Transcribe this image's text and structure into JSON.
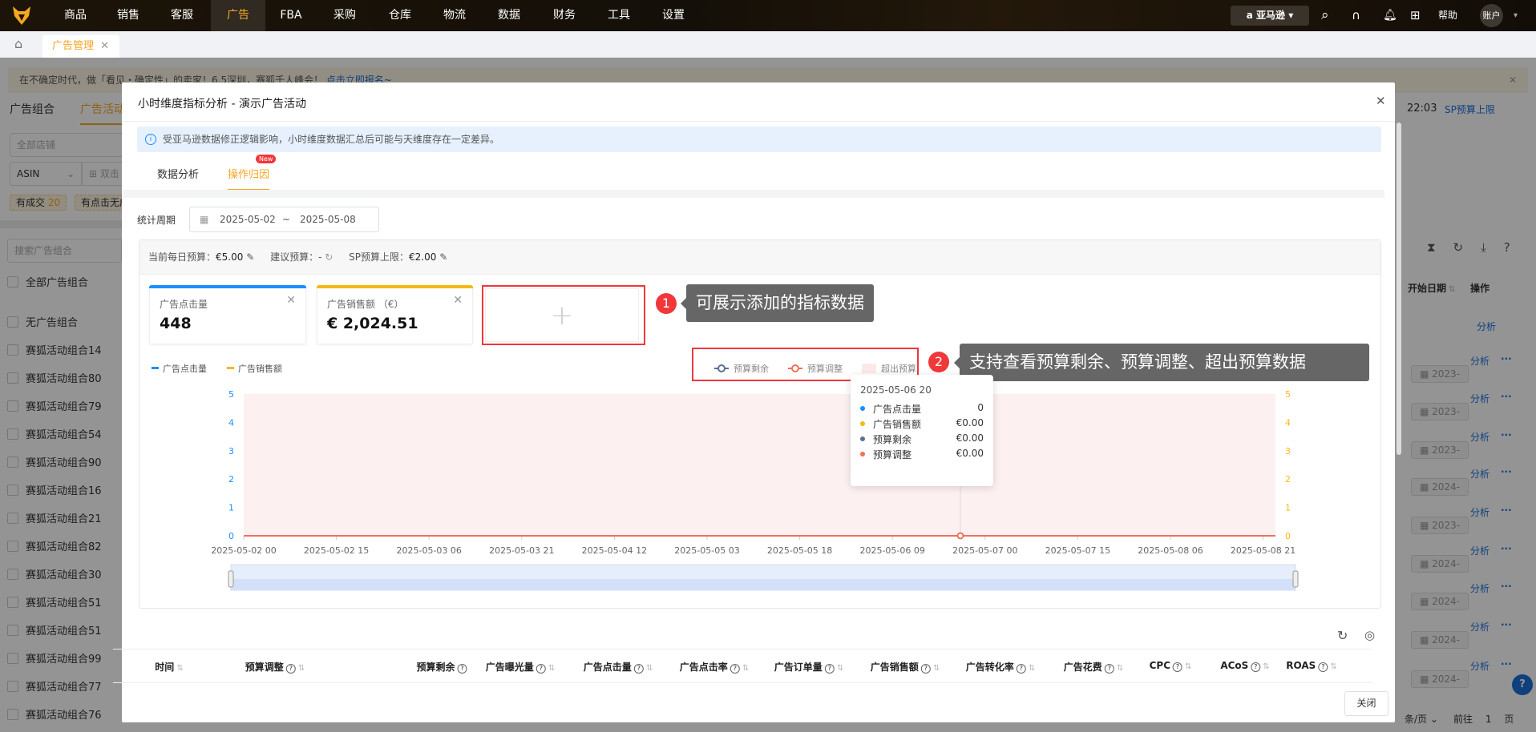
{
  "nav": {
    "items": [
      "商品",
      "销售",
      "客服",
      "广告",
      "FBA",
      "采购",
      "仓库",
      "物流",
      "数据",
      "财务",
      "工具",
      "设置"
    ],
    "active": "广告",
    "marketplace": "亚马逊",
    "help": "帮助",
    "account": "账户",
    "brand_color": "#f5a623"
  },
  "tabs": {
    "page_tab": "广告管理"
  },
  "background": {
    "banner": "在不确定时代，做「看见・确定性」的卖家！6.5深圳，赛狐千人峰会！",
    "banner_link": "点击立即报名~",
    "tab_group": "广告组合",
    "tab_campaign": "广告活动",
    "store_placeholder": "全部店铺",
    "asin_select": "ASIN",
    "search_hint": "双击",
    "filter1": "有成交",
    "filter1_count": "20",
    "filter2": "有点击无成",
    "group_search_placeholder": "搜索广告组合",
    "all_groups": "全部广告组合",
    "groups": [
      "无广告组合",
      "赛狐活动组合14",
      "赛狐活动组合80",
      "赛狐活动组合79",
      "赛狐活动组合54",
      "赛狐活动组合90",
      "赛狐活动组合16",
      "赛狐活动组合21",
      "赛狐活动组合82",
      "赛狐活动组合30",
      "赛狐活动组合51",
      "赛狐活动组合51",
      "赛狐活动组合99",
      "赛狐活动组合77",
      "赛狐活动组合76"
    ],
    "time": "22:03",
    "sp_limit": "SP预算上限",
    "col_start": "开始日期",
    "col_action": "操作",
    "action_analyze": "分析",
    "more": "···",
    "start_dates": [
      "2023-",
      "2023-",
      "2023-",
      "2024-",
      "2023-",
      "2024-",
      "2024-",
      "2024-",
      "2024-"
    ],
    "per_page": "条/页",
    "goto": "前往",
    "page": "1",
    "page_unit": "页"
  },
  "modal": {
    "title": "小时维度指标分析 - 演示广告活动",
    "alert": "受亚马逊数据修正逻辑影响，小时维度数据汇总后可能与天维度存在一定差异。",
    "tabs": [
      {
        "label": "数据分析"
      },
      {
        "label": "操作归因",
        "badge": "New",
        "active": true
      }
    ],
    "period_label": "统计周期",
    "date_start": "2025-05-02",
    "date_sep": "~",
    "date_end": "2025-05-08",
    "budget": {
      "daily_label": "当前每日预算：",
      "daily_value": "€5.00",
      "suggest_label": "建议预算：",
      "suggest_value": "-",
      "sp_label": "SP预算上限：",
      "sp_value": "€2.00"
    },
    "metrics": [
      {
        "label": "广告点击量",
        "value": "448",
        "color": "#1890ff"
      },
      {
        "label": "广告销售额 （€）",
        "value": "€ 2,024.51",
        "color": "#f5b914"
      }
    ],
    "callouts": [
      {
        "num": "1",
        "text": "可展示添加的指标数据"
      },
      {
        "num": "2",
        "text": "支持查看预算剩余、预算调整、超出预算数据"
      }
    ],
    "close": "关闭",
    "table_headers": [
      "时间",
      "预算调整",
      "预算剩余",
      "广告曝光量",
      "广告点击量",
      "广告点击率",
      "广告订单量",
      "广告销售额",
      "广告转化率",
      "广告花费",
      "CPC",
      "ACoS",
      "ROAS"
    ]
  },
  "chart_data": {
    "type": "line",
    "x_start": "2025-05-02 00",
    "x_end": "2025-05-08 23",
    "x_interval": "1 hour",
    "x_tick_labels": [
      "2025-05-02 00",
      "2025-05-02 15",
      "2025-05-03 06",
      "2025-05-03 21",
      "2025-05-04 12",
      "2025-05-05 03",
      "2025-05-05 18",
      "2025-05-06 09",
      "2025-05-07 00",
      "2025-05-07 15",
      "2025-05-08 06",
      "2025-05-08 21"
    ],
    "y_left": {
      "ticks": [
        0,
        1,
        2,
        3,
        4,
        5
      ],
      "range": [
        0,
        5
      ],
      "color": "#1890ff"
    },
    "y_right": {
      "ticks": [
        0,
        1,
        2,
        3,
        4,
        5
      ],
      "range": [
        0,
        5
      ],
      "color": "#f5b914"
    },
    "legend_left": [
      {
        "name": "广告点击量",
        "color": "#1890ff"
      },
      {
        "name": "广告销售额",
        "color": "#f5b914"
      }
    ],
    "legend_right": [
      {
        "name": "预算剩余",
        "color": "#5b6e96"
      },
      {
        "name": "预算调整",
        "color": "#f0705a"
      },
      {
        "name": "超出预算",
        "color": "#fdf0f0"
      }
    ],
    "series": [
      {
        "name": "广告点击量",
        "constant_value": 0
      },
      {
        "name": "广告销售额",
        "constant_value": 0
      },
      {
        "name": "预算剩余",
        "constant_value": 0
      },
      {
        "name": "预算调整",
        "constant_value": 0
      }
    ],
    "over_budget_range": [
      "2025-05-02 00",
      "2025-05-08 23"
    ],
    "tooltip": {
      "x": "2025-05-06 20",
      "rows": [
        {
          "name": "广告点击量",
          "value": "0",
          "color": "#1890ff"
        },
        {
          "name": "广告销售额",
          "value": "€0.00",
          "color": "#f5b914"
        },
        {
          "name": "预算剩余",
          "value": "€0.00",
          "color": "#5b6e96"
        },
        {
          "name": "预算调整",
          "value": "€0.00",
          "color": "#f0705a"
        }
      ]
    },
    "grid": false,
    "legend_placement": "top"
  }
}
